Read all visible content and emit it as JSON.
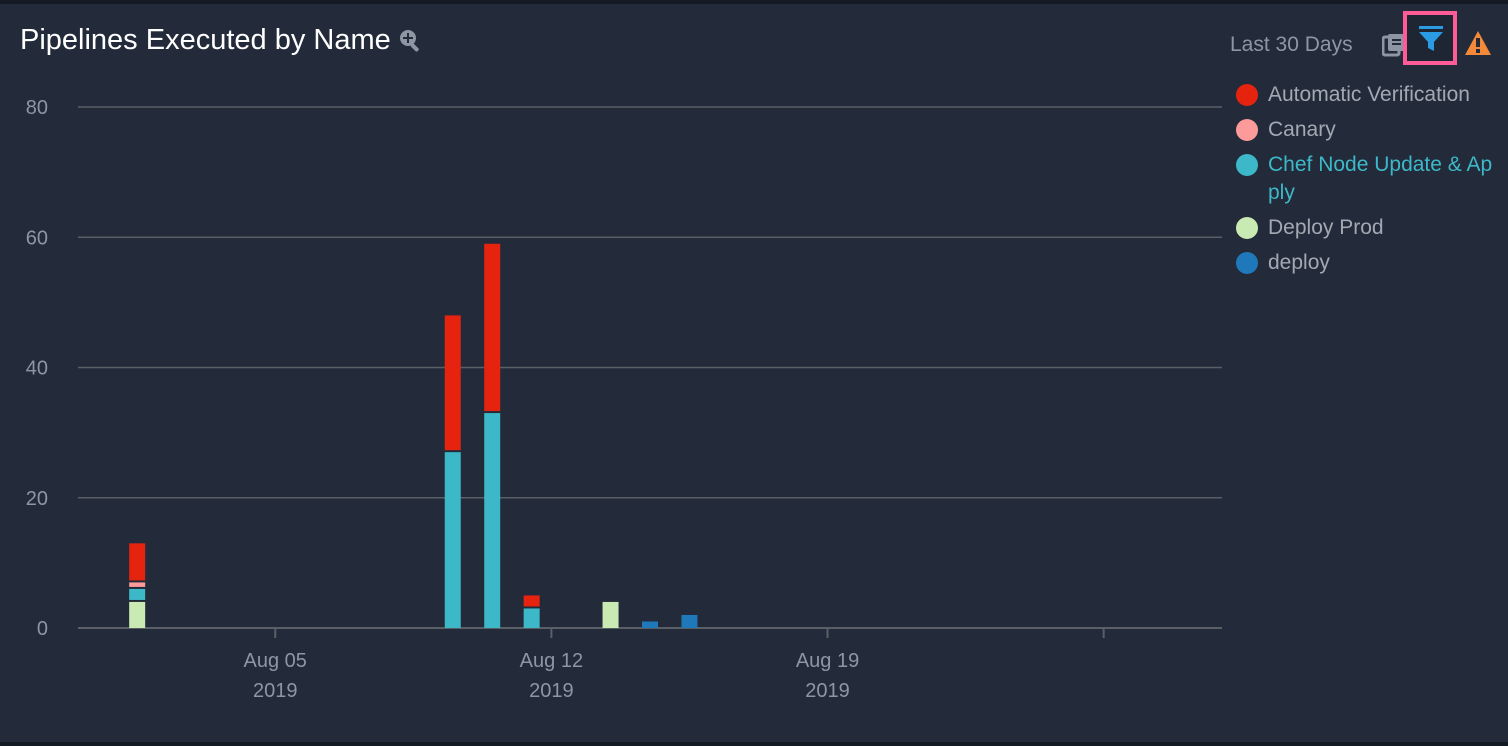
{
  "header": {
    "title": "Pipelines Executed by Name",
    "zoom_icon": "zoom-in-icon",
    "range_label": "Last 30 Days",
    "icons": [
      "copy-icon",
      "filter-icon",
      "warning-icon"
    ]
  },
  "colors": {
    "background": "#232b3a",
    "filter_highlight": "#ff5c97",
    "filter_icon": "#2b9be3",
    "warning_icon": "#f5893a"
  },
  "chart_data": {
    "type": "bar",
    "stacked": true,
    "title": "Pipelines Executed by Name",
    "xlabel": "",
    "ylabel": "",
    "ylim": [
      0,
      80
    ],
    "yticks": [
      0,
      20,
      40,
      60,
      80
    ],
    "xrange_days": [
      "2019-07-31",
      "2019-08-29"
    ],
    "xticks": [
      {
        "date": "2019-08-05",
        "label": "Aug 05",
        "sub": "2019"
      },
      {
        "date": "2019-08-12",
        "label": "Aug 12",
        "sub": "2019"
      },
      {
        "date": "2019-08-19",
        "label": "Aug 19",
        "sub": "2019"
      },
      {
        "date": "2019-08-26",
        "label": "",
        "sub": ""
      }
    ],
    "grid": true,
    "legend_position": "right",
    "categories": [
      "2019-08-01",
      "2019-08-09",
      "2019-08-10",
      "2019-08-11",
      "2019-08-13",
      "2019-08-14",
      "2019-08-15"
    ],
    "series": [
      {
        "name": "Deploy Prod",
        "color": "#c9eab2",
        "values": [
          4,
          0,
          0,
          0,
          4,
          0,
          0
        ]
      },
      {
        "name": "Chef Node Update & Apply",
        "color": "#3db8c8",
        "values": [
          2,
          27,
          33,
          3,
          0,
          0,
          0
        ]
      },
      {
        "name": "Canary",
        "color": "#fd9a9a",
        "values": [
          1,
          0,
          0,
          0,
          0,
          0,
          0
        ]
      },
      {
        "name": "Automatic Verification",
        "color": "#e6230e",
        "values": [
          6,
          21,
          26,
          2,
          0,
          0,
          0
        ]
      },
      {
        "name": "deploy",
        "color": "#1f78b9",
        "values": [
          0,
          0,
          0,
          0,
          0,
          1,
          2
        ]
      }
    ]
  },
  "legend": {
    "items": [
      {
        "label": "Automatic Verification",
        "color": "#e6230e",
        "active": false
      },
      {
        "label": "Canary",
        "color": "#fd9a9a",
        "active": false
      },
      {
        "label": "Chef Node Update & Apply",
        "color": "#3db8c8",
        "active": true
      },
      {
        "label": "Deploy Prod",
        "color": "#c9eab2",
        "active": false
      },
      {
        "label": "deploy",
        "color": "#1f78b9",
        "active": false
      }
    ]
  }
}
